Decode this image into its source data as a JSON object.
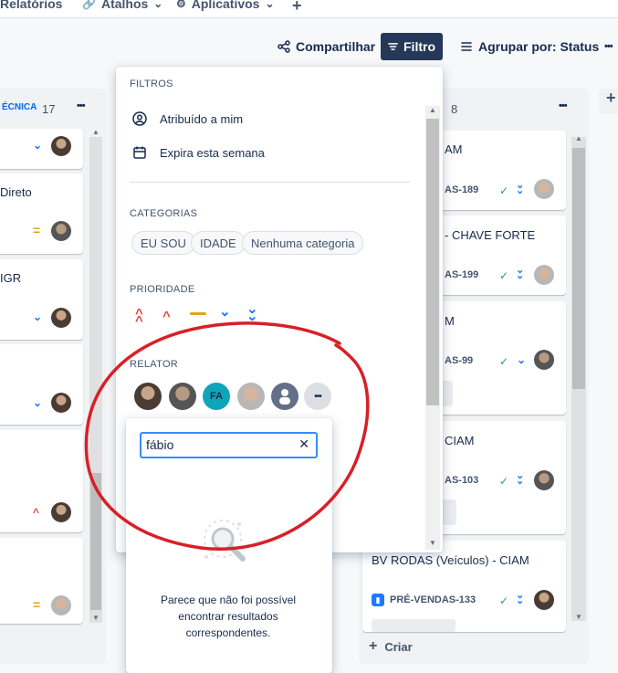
{
  "nav": {
    "items": [
      {
        "icon": "chart-icon",
        "label": "Relatórios"
      },
      {
        "icon": "link-icon",
        "label": "Atalhos"
      },
      {
        "icon": "apps-icon",
        "label": "Aplicativos"
      }
    ],
    "add_label": "+"
  },
  "toolbar": {
    "share_label": "Compartilhar",
    "filter_label": "Filtro",
    "group_label": "Agrupar por: Status",
    "more_label": "•••"
  },
  "left_column": {
    "tag": "ÉCNICA",
    "count": "17",
    "menu": "•••",
    "cards": [
      {
        "title": "",
        "priority": "low"
      },
      {
        "title": "Direto",
        "priority": "medium"
      },
      {
        "title": "IGR",
        "priority": "low"
      },
      {
        "title": "",
        "priority": "low"
      },
      {
        "title": "",
        "priority": "high"
      },
      {
        "title": "",
        "priority": "medium"
      }
    ]
  },
  "right_column": {
    "count": "8",
    "menu": "•••",
    "cards": [
      {
        "title": "AM",
        "key": "AS-189"
      },
      {
        "title": "- CHAVE FORTE",
        "key": "AS-199"
      },
      {
        "title": "M",
        "key": "AS-99"
      },
      {
        "title": "CIAM",
        "key": "AS-103"
      },
      {
        "title": "BV RODAS (Veículos) - CIAM",
        "key": "PRÉ-VENDAS-133"
      }
    ],
    "create_label": "Criar"
  },
  "filter_popup": {
    "filters_title": "FILTROS",
    "assigned_to_me": "Atribuído a mim",
    "due_this_week": "Expira esta semana",
    "categories_title": "CATEGORIAS",
    "categories": [
      "EU SOU",
      "IDADE",
      "Nenhuma categoria"
    ],
    "priority_title": "PRIORIDADE",
    "reporter_title": "RELATOR",
    "reporter_initials": "FA",
    "more_label": "•••"
  },
  "reporter_search": {
    "value": "fábio",
    "clear_label": "✕",
    "empty_message": "Parece que não foi possível encontrar resultados correspondentes."
  },
  "annotation_color": "#d91f26"
}
